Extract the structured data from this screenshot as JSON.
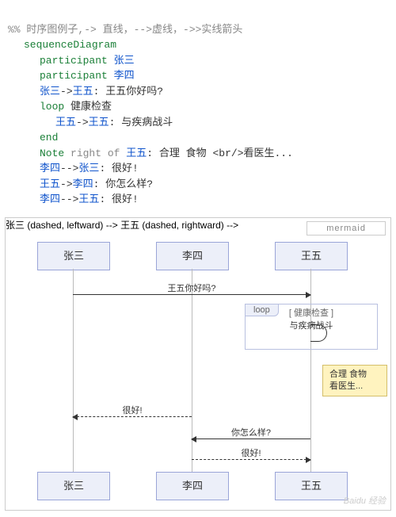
{
  "code": {
    "c1": "%% 时序图例子,-> 直线，-->虚线，->>实线箭头",
    "kw_seq": "sequenceDiagram",
    "kw_part": "participant",
    "kw_loop": "loop",
    "kw_end": "end",
    "kw_note": "Note",
    "kw_right_of": "right of",
    "p1": "张三",
    "p2": "李四",
    "p3": "王五",
    "m1_arrow": "->",
    "m1_text": ": 王五你好吗?",
    "loop_title": "健康检查",
    "m2_arrow": "->",
    "m2_text": ": 与疾病战斗",
    "note_text": ": 合理 食物 <br/>看医生...",
    "m3_arrow": "-->",
    "m3_text": ": 很好!",
    "m4_arrow": "->",
    "m4_text": ": 你怎么样?",
    "m5_arrow": "-->",
    "m5_text": ": 很好!"
  },
  "diagram": {
    "badge": "mermaid",
    "actors": {
      "a1": "张三",
      "a2": "李四",
      "a3": "王五"
    },
    "msg1": "王五你好吗?",
    "loop_tab": "loop",
    "loop_title": "[  健康检查  ]",
    "loop_sub": "与疾病战斗",
    "note_l1": "合理  食物",
    "note_l2": "看医生...",
    "msg2": "很好!",
    "msg3": "你怎么样?",
    "msg4": "很好!",
    "watermark": "Baidu 经验"
  }
}
